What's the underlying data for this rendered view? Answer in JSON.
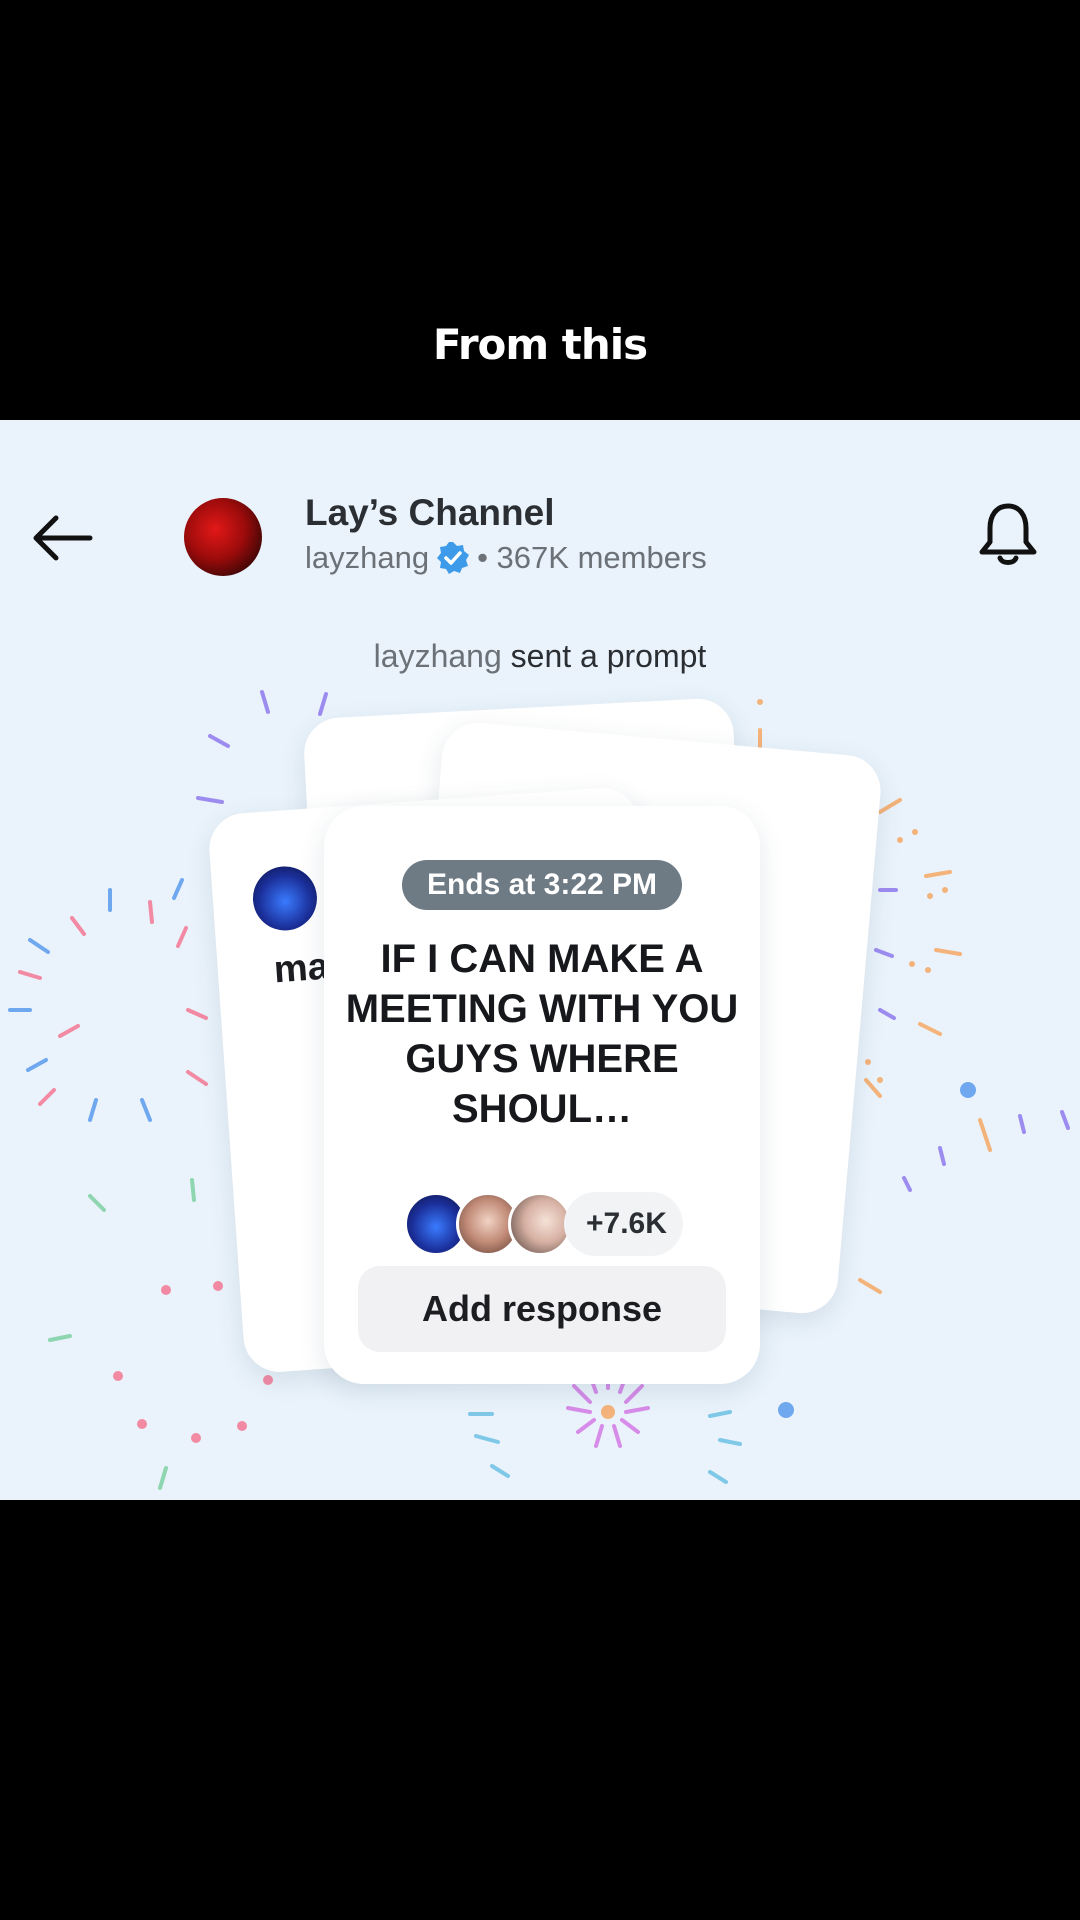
{
  "overlay": {
    "caption": "From this"
  },
  "header": {
    "back_icon": "arrow-left-icon",
    "channel_title": "Lay’s Channel",
    "username": "layzhang",
    "verified_icon": "verified-badge-icon",
    "members": "• 367K members",
    "bell_icon": "bell-icon"
  },
  "prompt_banner": {
    "user": "layzhang",
    "text": " sent a prompt"
  },
  "back_card": {
    "partial_text": "ma"
  },
  "prompt_card": {
    "ends_label": "Ends at 3:22 PM",
    "question": "IF I CAN MAKE A MEETING WITH YOU GUYS WHERE SHOUL…",
    "response_count": "+7.6K",
    "add_response_label": "Add response"
  },
  "colors": {
    "panel_bg": "#eaf3fb",
    "ends_pill": "#6e7a84",
    "verified": "#3d9be9"
  }
}
